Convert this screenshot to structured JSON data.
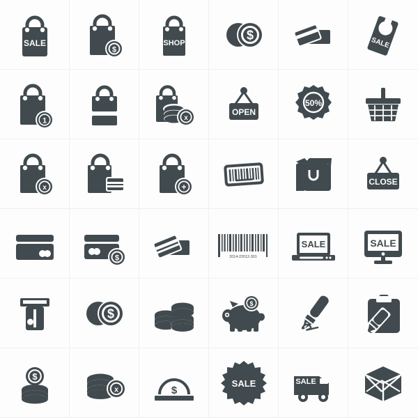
{
  "page": {
    "title": "Shopping and Commerce Icon Set",
    "background_color": "#fdfdfd",
    "icon_color": "#414a4e",
    "grid_line_color": "#f0f0f0",
    "columns": 6,
    "rows": 6,
    "icon_count": 36
  },
  "icons": [
    {
      "id": "shopping-bag-sale",
      "name": "shopping-bag-sale-icon",
      "label": "SALE",
      "row": 1,
      "col": 1
    },
    {
      "id": "shopping-bag-dollar",
      "name": "shopping-bag-dollar-icon",
      "label": "$",
      "row": 1,
      "col": 2
    },
    {
      "id": "shopping-bag-shop",
      "name": "shopping-bag-shop-icon",
      "label": "SHOP",
      "row": 1,
      "col": 3
    },
    {
      "id": "coins-dollar",
      "name": "coins-dollar-icon",
      "label": "$",
      "row": 1,
      "col": 4
    },
    {
      "id": "credit-cards-pair",
      "name": "credit-cards-pair-icon",
      "label": "",
      "row": 1,
      "col": 5
    },
    {
      "id": "door-hanger-sale",
      "name": "door-hanger-sale-icon",
      "label": "SALE",
      "row": 1,
      "col": 6
    },
    {
      "id": "shopping-bag-one",
      "name": "shopping-bag-one-icon",
      "label": "1",
      "row": 2,
      "col": 1
    },
    {
      "id": "shopping-bag-split",
      "name": "shopping-bag-split-icon",
      "label": "",
      "row": 2,
      "col": 2
    },
    {
      "id": "shopping-bag-coins-remove",
      "name": "shopping-bag-coins-remove-icon",
      "label": "x",
      "row": 2,
      "col": 3
    },
    {
      "id": "open-sign",
      "name": "open-sign-icon",
      "label": "OPEN",
      "row": 2,
      "col": 4
    },
    {
      "id": "discount-badge-50",
      "name": "discount-badge-50-icon",
      "label": "50%",
      "row": 2,
      "col": 5
    },
    {
      "id": "shopping-basket",
      "name": "shopping-basket-icon",
      "label": "",
      "row": 2,
      "col": 6
    },
    {
      "id": "shopping-bag-remove",
      "name": "shopping-bag-remove-icon",
      "label": "x",
      "row": 3,
      "col": 1
    },
    {
      "id": "shopping-bag-card",
      "name": "shopping-bag-card-icon",
      "label": "",
      "row": 3,
      "col": 2
    },
    {
      "id": "shopping-bag-add",
      "name": "shopping-bag-add-icon",
      "label": "+",
      "row": 3,
      "col": 3
    },
    {
      "id": "barcode-scan",
      "name": "barcode-scan-icon",
      "label": "",
      "row": 3,
      "col": 4
    },
    {
      "id": "shopping-bags-stack",
      "name": "shopping-bags-stack-icon",
      "label": "",
      "row": 3,
      "col": 5
    },
    {
      "id": "close-sign",
      "name": "close-sign-icon",
      "label": "CLOSE",
      "row": 3,
      "col": 6
    },
    {
      "id": "credit-card-stripe",
      "name": "credit-card-stripe-icon",
      "label": "",
      "row": 4,
      "col": 1
    },
    {
      "id": "credit-card-dollar",
      "name": "credit-card-dollar-icon",
      "label": "$",
      "row": 4,
      "col": 2
    },
    {
      "id": "credit-cards-tilted",
      "name": "credit-cards-tilted-icon",
      "label": "",
      "row": 4,
      "col": 3
    },
    {
      "id": "barcode-number",
      "name": "barcode-number-icon",
      "label": "2014-22012-301",
      "row": 4,
      "col": 4
    },
    {
      "id": "laptop-sale",
      "name": "laptop-sale-icon",
      "label": "SALE",
      "row": 4,
      "col": 5
    },
    {
      "id": "monitor-sale",
      "name": "monitor-sale-icon",
      "label": "SALE",
      "row": 4,
      "col": 6
    },
    {
      "id": "atm-card-slot",
      "name": "atm-card-slot-icon",
      "label": "",
      "row": 5,
      "col": 1
    },
    {
      "id": "coins-pair-dollar",
      "name": "coins-pair-dollar-icon",
      "label": "$",
      "row": 5,
      "col": 2
    },
    {
      "id": "coin-stacks",
      "name": "coin-stacks-icon",
      "label": "",
      "row": 5,
      "col": 3
    },
    {
      "id": "piggy-bank",
      "name": "piggy-bank-icon",
      "label": "$",
      "row": 5,
      "col": 4
    },
    {
      "id": "fountain-pen-signature",
      "name": "fountain-pen-signature-icon",
      "label": "",
      "row": 5,
      "col": 5
    },
    {
      "id": "clipboard-pen",
      "name": "clipboard-pen-icon",
      "label": "",
      "row": 5,
      "col": 6
    },
    {
      "id": "coin-stack-dollar",
      "name": "coin-stack-dollar-icon",
      "label": "$",
      "row": 6,
      "col": 1
    },
    {
      "id": "coin-stack-remove",
      "name": "coin-stack-remove-icon",
      "label": "x",
      "row": 6,
      "col": 2
    },
    {
      "id": "money-dome-dollar",
      "name": "money-dome-dollar-icon",
      "label": "$",
      "row": 6,
      "col": 3
    },
    {
      "id": "sale-starburst-badge",
      "name": "sale-starburst-badge-icon",
      "label": "SALE",
      "row": 6,
      "col": 4
    },
    {
      "id": "delivery-van-sale",
      "name": "delivery-van-sale-icon",
      "label": "SALE",
      "row": 6,
      "col": 5
    },
    {
      "id": "package-box",
      "name": "package-box-icon",
      "label": "",
      "row": 6,
      "col": 6
    }
  ]
}
